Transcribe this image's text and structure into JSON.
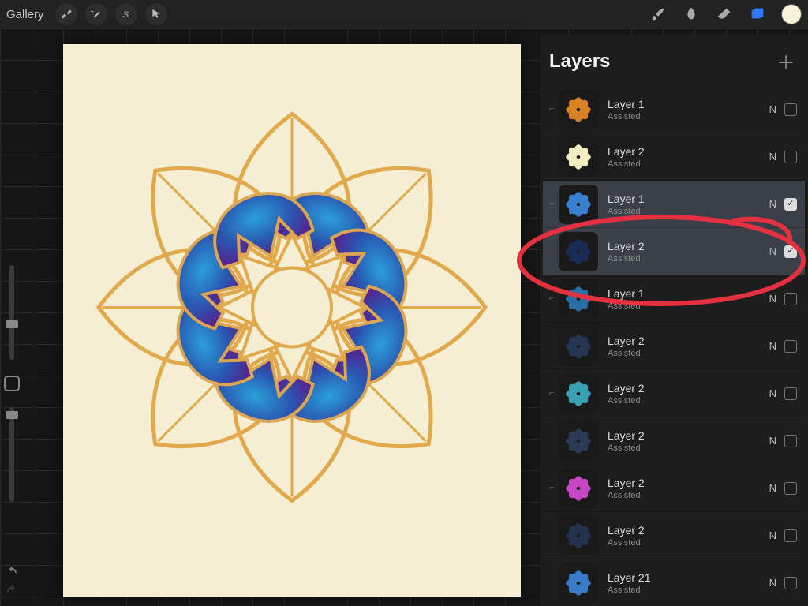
{
  "toolbar": {
    "gallery_label": "Gallery"
  },
  "layers_panel": {
    "title": "Layers",
    "blend_letter": "N",
    "assisted_label": "Assisted",
    "items": [
      {
        "name": "Layer 1",
        "sub": "Assisted",
        "checked": false,
        "selected": false,
        "indent": true,
        "thumb_color": "#d98124"
      },
      {
        "name": "Layer 2",
        "sub": "Assisted",
        "checked": false,
        "selected": false,
        "indent": false,
        "thumb_color": "#f4eec2"
      },
      {
        "name": "Layer 1",
        "sub": "Assisted",
        "checked": true,
        "selected": true,
        "indent": true,
        "thumb_color": "#3780d0"
      },
      {
        "name": "Layer 2",
        "sub": "Assisted",
        "checked": true,
        "selected": true,
        "indent": false,
        "thumb_color": "#1a2c55"
      },
      {
        "name": "Layer 1",
        "sub": "Assisted",
        "checked": false,
        "selected": false,
        "indent": true,
        "thumb_color": "#2a6ea8"
      },
      {
        "name": "Layer 2",
        "sub": "Assisted",
        "checked": false,
        "selected": false,
        "indent": false,
        "thumb_color": "#243651"
      },
      {
        "name": "Layer 2",
        "sub": "Assisted",
        "checked": false,
        "selected": false,
        "indent": true,
        "thumb_color": "#3aa0b3"
      },
      {
        "name": "Layer 2",
        "sub": "Assisted",
        "checked": false,
        "selected": false,
        "indent": false,
        "thumb_color": "#2b3a55"
      },
      {
        "name": "Layer 2",
        "sub": "Assisted",
        "checked": false,
        "selected": false,
        "indent": true,
        "thumb_color": "#c646c6"
      },
      {
        "name": "Layer 2",
        "sub": "Assisted",
        "checked": false,
        "selected": false,
        "indent": false,
        "thumb_color": "#23334e"
      },
      {
        "name": "Layer 21",
        "sub": "Assisted",
        "checked": false,
        "selected": false,
        "indent": false,
        "thumb_color": "#3a7ac8"
      }
    ]
  },
  "colors": {
    "accent": "#2f7bff",
    "swatch": "#f7f2d8",
    "annotation": "#e02a2a"
  }
}
